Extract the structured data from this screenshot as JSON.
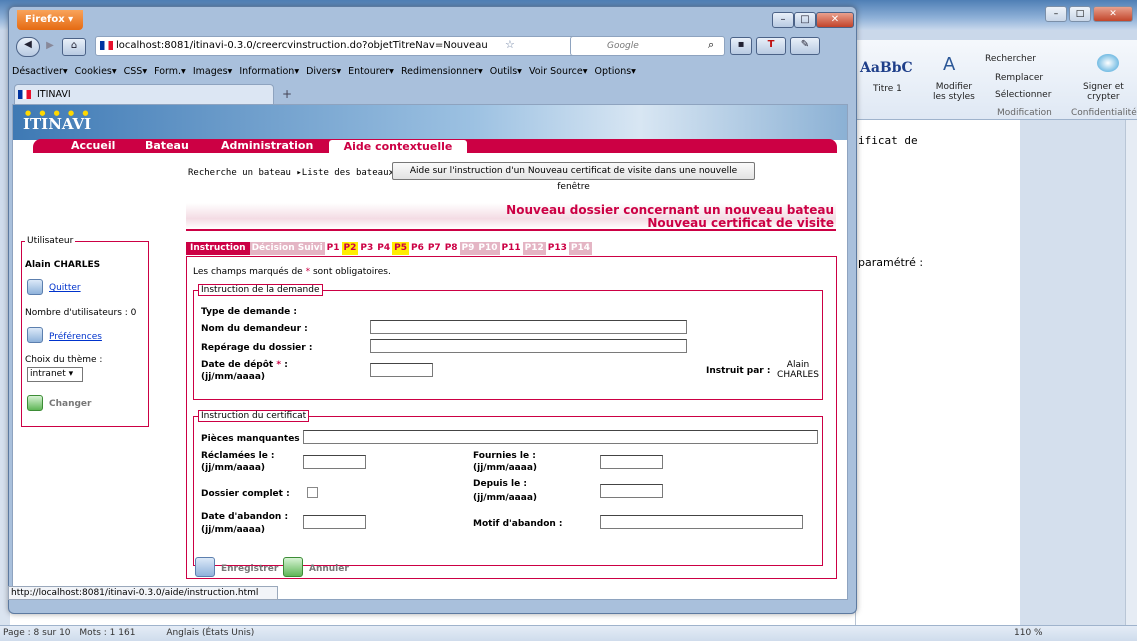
{
  "browser": {
    "menu_button": "Firefox",
    "url": "localhost:8081/itinavi-0.3.0/creercvinstruction.do?objetTitreNav=Nouveau",
    "search_placeholder": "Google",
    "tab_title": "ITINAVI",
    "status_url": "http://localhost:8081/itinavi-0.3.0/aide/instruction.html"
  },
  "webdev_toolbar": {
    "items": [
      "Désactiver",
      "Cookies",
      "CSS",
      "Form.",
      "Images",
      "Information",
      "Divers",
      "Entourer",
      "Redimensionner",
      "Outils",
      "Voir Source",
      "Options"
    ]
  },
  "word": {
    "style_preview": "AaBbC",
    "style_name": "Titre 1",
    "modifier_styles": "Modifier\nles styles",
    "rechercher": "Rechercher",
    "remplacer": "Remplacer",
    "selectionner": "Sélectionner",
    "signer": "Signer et\ncrypter",
    "group_modification": "Modification",
    "group_conf": "Confidentialité",
    "doc_text1": "ificat de",
    "doc_text2": "paramétré :",
    "status_page": "Page : 8 sur 10",
    "status_words": "Mots : 1 161",
    "status_lang": "Anglais (États Unis)",
    "zoom": "110 %"
  },
  "site": {
    "logo": "ITINAVI",
    "menu": [
      "Accueil",
      "Bateau",
      "Administration"
    ],
    "aide": "Aide contextuelle",
    "breadcrumb": "Recherche un bateau ▸Liste des bateaux",
    "help_button": "Aide sur l'instruction d'un Nouveau certificat de visite dans une nouvelle fenêtre",
    "title1": "Nouveau dossier concernant un nouveau bateau",
    "title2": "Nouveau certificat de visite"
  },
  "user": {
    "legend": "Utilisateur",
    "name": "Alain CHARLES",
    "quit": "Quitter",
    "count": "Nombre d'utilisateurs : 0",
    "prefs": "Préférences",
    "theme_label": "Choix du thème :",
    "theme_value": "intranet",
    "change": "Changer"
  },
  "tabs": [
    {
      "label": "Instruction",
      "style": "act"
    },
    {
      "label": "Décision Suivi",
      "style": "dis"
    },
    {
      "label": "P1",
      "style": ""
    },
    {
      "label": "P2",
      "style": "yel"
    },
    {
      "label": "P3",
      "style": ""
    },
    {
      "label": "P4",
      "style": ""
    },
    {
      "label": "P5",
      "style": "yel"
    },
    {
      "label": "P6",
      "style": ""
    },
    {
      "label": "P7",
      "style": ""
    },
    {
      "label": "P8",
      "style": ""
    },
    {
      "label": "P9",
      "style": "dis"
    },
    {
      "label": "P10",
      "style": "dis"
    },
    {
      "label": "P11",
      "style": ""
    },
    {
      "label": "P12",
      "style": "dis"
    },
    {
      "label": "P13",
      "style": ""
    },
    {
      "label": "P14",
      "style": "dis"
    }
  ],
  "form": {
    "mandatory_note": "Les champs marqués de",
    "mandatory_star": "*",
    "mandatory_end": "sont obligatoires.",
    "fs1_legend": "Instruction de la demande",
    "type": "Type de demande :",
    "nom": "Nom du demandeur :",
    "reperage": "Repérage du dossier :",
    "date_depot": "Date de dépôt",
    "date_fmt": "(jj/mm/aaaa)",
    "instruit": "Instruit par :",
    "instruit_val": "Alain CHARLES",
    "fs2_legend": "Instruction du certificat",
    "pieces": "Pièces manquantes :",
    "reclamees": "Réclamées le :",
    "fournies": "Fournies le :",
    "complet": "Dossier complet :",
    "depuis": "Depuis le :",
    "abandon": "Date d'abandon :",
    "motif": "Motif d'abandon :",
    "enregistrer": "Enregistrer",
    "annuler": "Annuler"
  }
}
